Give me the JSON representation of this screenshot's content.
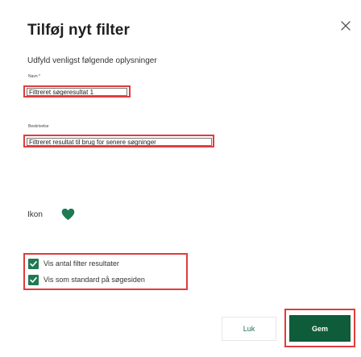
{
  "dialog": {
    "title": "Tilføj nyt filter",
    "subtitle": "Udfyld venligst følgende oplysninger",
    "close_icon": "close-icon"
  },
  "form": {
    "name": {
      "label": "Navn *",
      "value": "Filtreret søgeresultat 1"
    },
    "description": {
      "label": "Beskrivelse",
      "value": "Filtreret resultat til brug for senere søgninger"
    },
    "icon": {
      "label": "Ikon",
      "icon_name": "heart-icon",
      "color": "#1e7a52"
    },
    "checkboxes": [
      {
        "label": "Vis antal filter resultater",
        "checked": true
      },
      {
        "label": "Vis som standard på søgesiden",
        "checked": true
      }
    ]
  },
  "buttons": {
    "close_label": "Luk",
    "save_label": "Gem"
  },
  "colors": {
    "accent": "#0e5c3a",
    "checkbox": "#1e7a52",
    "highlight": "#e03c3c"
  }
}
